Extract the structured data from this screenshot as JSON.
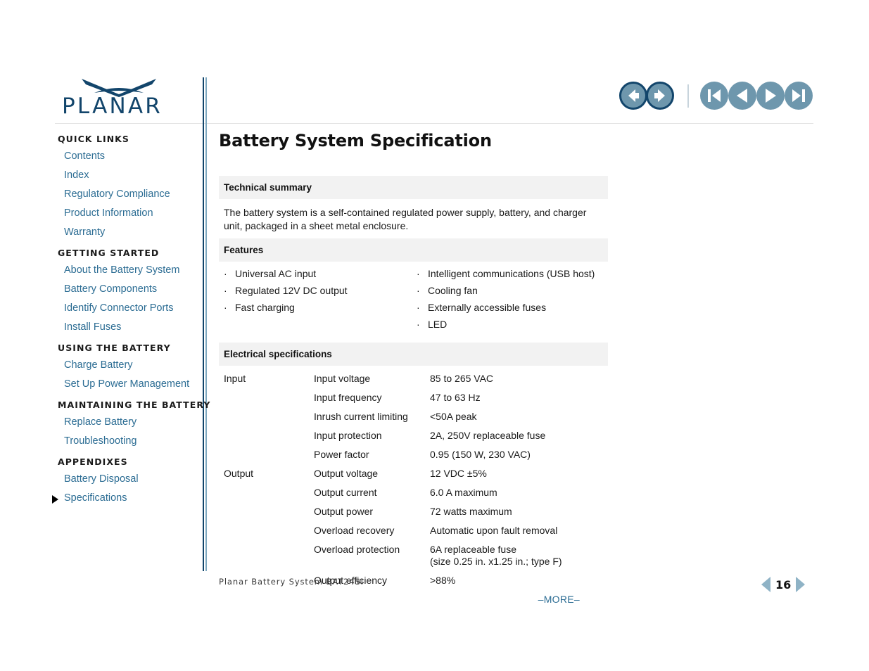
{
  "brand": {
    "name": "PLANAR",
    "logo_color": "#12456b"
  },
  "topnav": {
    "buttons": [
      {
        "name": "back-button",
        "icon": "arrow-left-icon",
        "style": "ringed"
      },
      {
        "name": "forward-button",
        "icon": "arrow-right-icon",
        "style": "ringed"
      },
      {
        "name": "first-page-button",
        "icon": "skip-to-start-icon",
        "style": "plain"
      },
      {
        "name": "previous-page-button",
        "icon": "triangle-left-icon",
        "style": "plain"
      },
      {
        "name": "next-page-button",
        "icon": "triangle-right-icon",
        "style": "plain"
      },
      {
        "name": "last-page-button",
        "icon": "skip-to-end-icon",
        "style": "plain"
      }
    ]
  },
  "sidebar": {
    "groups": [
      {
        "title": "QUICK LINKS",
        "items": [
          {
            "label": "Contents",
            "active": false
          },
          {
            "label": "Index",
            "active": false
          },
          {
            "label": "Regulatory Compliance",
            "active": false
          },
          {
            "label": "Product Information",
            "active": false
          },
          {
            "label": "Warranty",
            "active": false
          }
        ]
      },
      {
        "title": "GETTING STARTED",
        "items": [
          {
            "label": "About the Battery System",
            "active": false
          },
          {
            "label": "Battery Components",
            "active": false
          },
          {
            "label": "Identify Connector Ports",
            "active": false
          },
          {
            "label": "Install Fuses",
            "active": false
          }
        ]
      },
      {
        "title": "USING THE BATTERY",
        "items": [
          {
            "label": "Charge Battery",
            "active": false
          },
          {
            "label": "Set Up Power Management",
            "active": false
          }
        ]
      },
      {
        "title": "MAINTAINING THE BATTERY",
        "items": [
          {
            "label": "Replace Battery",
            "active": false
          },
          {
            "label": "Troubleshooting",
            "active": false
          }
        ]
      },
      {
        "title": "APPENDIXES",
        "items": [
          {
            "label": "Battery Disposal",
            "active": false
          },
          {
            "label": "Specifications",
            "active": true
          }
        ]
      }
    ]
  },
  "main": {
    "title": "Battery System Specification",
    "technical_summary": {
      "heading": "Technical summary",
      "text": "The battery system is a self-contained regulated power supply, battery, and charger unit, packaged in a sheet metal enclosure."
    },
    "features": {
      "heading": "Features",
      "bullet": "·",
      "left_column": [
        "Universal AC input",
        "Regulated 12V DC output",
        "Fast charging"
      ],
      "right_column": [
        "Intelligent communications (USB host)",
        "Cooling fan",
        "Externally accessible fuses",
        "LED"
      ]
    },
    "electrical": {
      "heading": "Electrical specifications",
      "rows": [
        {
          "group": "Input",
          "label": "Input voltage",
          "value": "85 to 265 VAC",
          "value2": ""
        },
        {
          "group": "",
          "label": "Input frequency",
          "value": "47 to 63 Hz",
          "value2": ""
        },
        {
          "group": "",
          "label": "Inrush current limiting",
          "value": "<50A peak",
          "value2": ""
        },
        {
          "group": "",
          "label": "Input protection",
          "value": "2A, 250V replaceable fuse",
          "value2": ""
        },
        {
          "group": "",
          "label": "Power factor",
          "value": "0.95 (150 W, 230 VAC)",
          "value2": ""
        },
        {
          "group": "Output",
          "label": "Output voltage",
          "value": "12 VDC ±5%",
          "value2": ""
        },
        {
          "group": "",
          "label": "Output current",
          "value": "6.0 A maximum",
          "value2": ""
        },
        {
          "group": "",
          "label": "Output power",
          "value": "72 watts maximum",
          "value2": ""
        },
        {
          "group": "",
          "label": "Overload recovery",
          "value": "Automatic upon fault removal",
          "value2": ""
        },
        {
          "group": "",
          "label": "Overload protection",
          "value": "6A replaceable fuse",
          "value2": "(size 0.25 in. x1.25 in.; type F)"
        },
        {
          "group": "",
          "label": "Output efficiency",
          "value": ">88%",
          "value2": ""
        }
      ]
    },
    "more_label": "–MORE–"
  },
  "footer": {
    "text": "Planar Battery System BAT24SI"
  },
  "pager": {
    "page_number": "16"
  }
}
